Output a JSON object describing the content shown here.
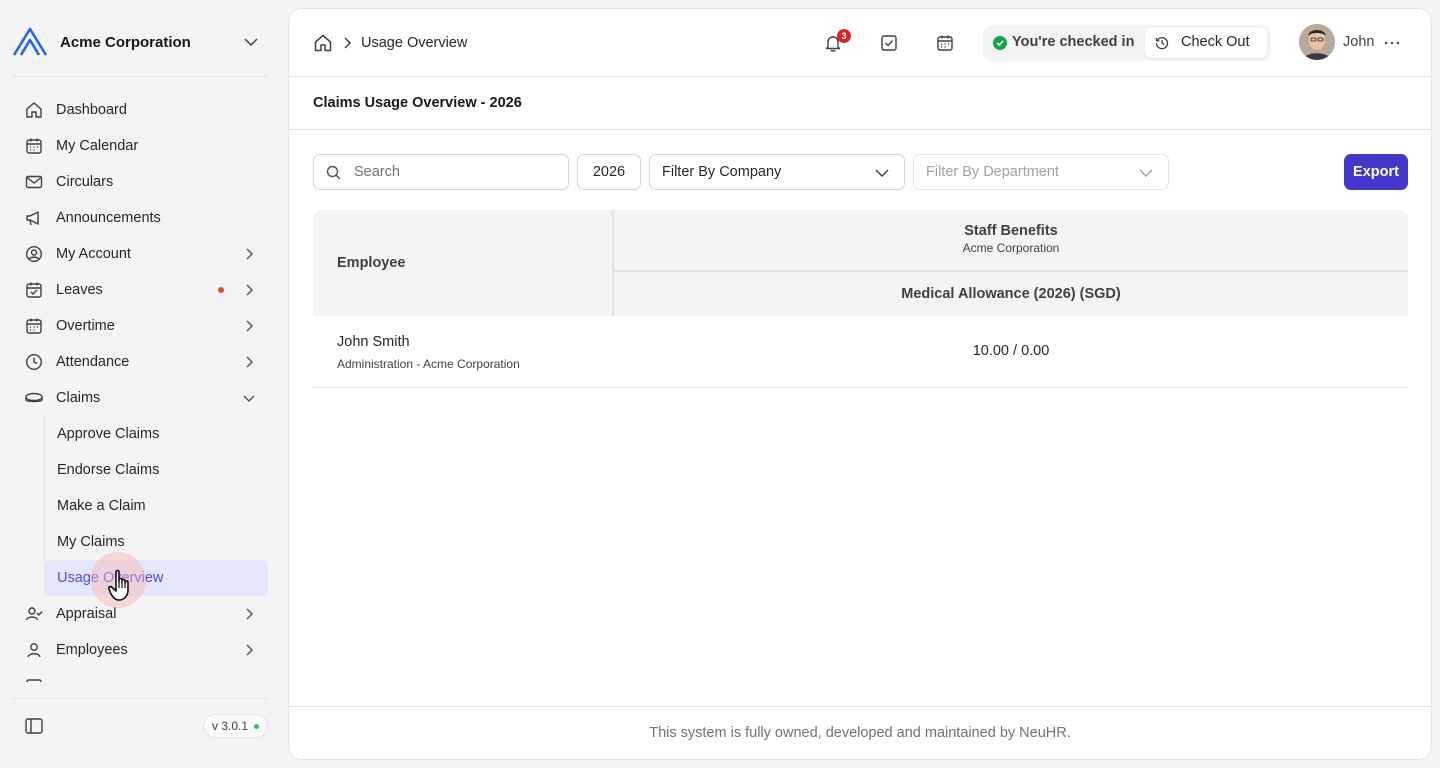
{
  "org": {
    "name": "Acme Corporation"
  },
  "colors": {
    "accent": "#4338ca",
    "active_bg": "#e4e7fb",
    "active_text": "#4f52d8",
    "alert": "#dc2626",
    "success": "#16a34a"
  },
  "sidebar": {
    "items": [
      {
        "label": "Dashboard",
        "icon": "home-icon"
      },
      {
        "label": "My Calendar",
        "icon": "calendar-icon"
      },
      {
        "label": "Circulars",
        "icon": "mail-icon"
      },
      {
        "label": "Announcements",
        "icon": "megaphone-icon"
      },
      {
        "label": "My Account",
        "icon": "user-circle-icon"
      },
      {
        "label": "Leaves",
        "icon": "calendar-check-icon"
      },
      {
        "label": "Overtime",
        "icon": "calendar-icon"
      },
      {
        "label": "Attendance",
        "icon": "clock-icon"
      },
      {
        "label": "Claims",
        "icon": "coins-icon"
      },
      {
        "label": "Appraisal",
        "icon": "user-check-icon"
      },
      {
        "label": "Employees",
        "icon": "user-icon"
      }
    ],
    "claims_sub": [
      {
        "label": "Approve Claims"
      },
      {
        "label": "Endorse Claims"
      },
      {
        "label": "Make a Claim"
      },
      {
        "label": "My Claims"
      },
      {
        "label": "Usage Overview"
      }
    ],
    "version": "v 3.0.1"
  },
  "header": {
    "breadcrumb_current": "Usage Overview",
    "notification_count": "3",
    "checkin_status": "You're checked in",
    "checkout_label": "Check Out",
    "user_name": "John"
  },
  "page": {
    "title": "Claims Usage Overview - 2026"
  },
  "filters": {
    "search_placeholder": "Search",
    "year": "2026",
    "company_placeholder": "Filter By Company",
    "department_placeholder": "Filter By Department",
    "export_label": "Export"
  },
  "table": {
    "employee_header": "Employee",
    "group_title": "Staff Benefits",
    "group_subtitle": "Acme Corporation",
    "column_header": "Medical Allowance (2026) (SGD)",
    "rows": [
      {
        "name": "John Smith",
        "dept": "Administration - Acme Corporation",
        "value": "10.00 / 0.00"
      }
    ]
  },
  "footer": {
    "text": "This system is fully owned, developed and maintained by NeuHR."
  }
}
